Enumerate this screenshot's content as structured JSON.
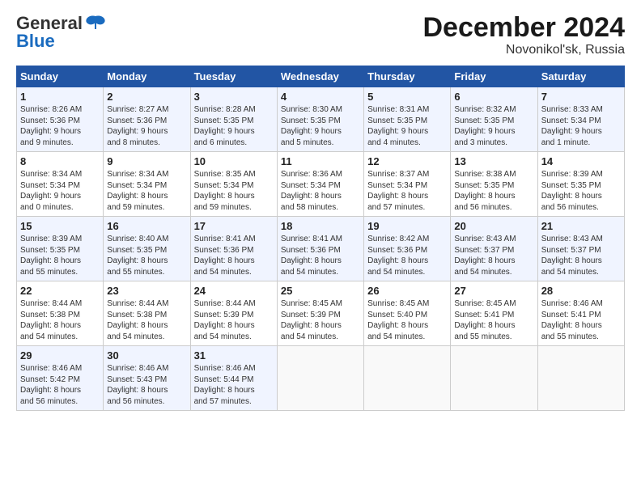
{
  "header": {
    "logo_general": "General",
    "logo_blue": "Blue",
    "title": "December 2024",
    "subtitle": "Novonikol'sk, Russia"
  },
  "columns": [
    "Sunday",
    "Monday",
    "Tuesday",
    "Wednesday",
    "Thursday",
    "Friday",
    "Saturday"
  ],
  "weeks": [
    [
      {
        "day": "1",
        "info": "Sunrise: 8:26 AM\nSunset: 5:36 PM\nDaylight: 9 hours\nand 9 minutes."
      },
      {
        "day": "2",
        "info": "Sunrise: 8:27 AM\nSunset: 5:36 PM\nDaylight: 9 hours\nand 8 minutes."
      },
      {
        "day": "3",
        "info": "Sunrise: 8:28 AM\nSunset: 5:35 PM\nDaylight: 9 hours\nand 6 minutes."
      },
      {
        "day": "4",
        "info": "Sunrise: 8:30 AM\nSunset: 5:35 PM\nDaylight: 9 hours\nand 5 minutes."
      },
      {
        "day": "5",
        "info": "Sunrise: 8:31 AM\nSunset: 5:35 PM\nDaylight: 9 hours\nand 4 minutes."
      },
      {
        "day": "6",
        "info": "Sunrise: 8:32 AM\nSunset: 5:35 PM\nDaylight: 9 hours\nand 3 minutes."
      },
      {
        "day": "7",
        "info": "Sunrise: 8:33 AM\nSunset: 5:34 PM\nDaylight: 9 hours\nand 1 minute."
      }
    ],
    [
      {
        "day": "8",
        "info": "Sunrise: 8:34 AM\nSunset: 5:34 PM\nDaylight: 9 hours\nand 0 minutes."
      },
      {
        "day": "9",
        "info": "Sunrise: 8:34 AM\nSunset: 5:34 PM\nDaylight: 8 hours\nand 59 minutes."
      },
      {
        "day": "10",
        "info": "Sunrise: 8:35 AM\nSunset: 5:34 PM\nDaylight: 8 hours\nand 59 minutes."
      },
      {
        "day": "11",
        "info": "Sunrise: 8:36 AM\nSunset: 5:34 PM\nDaylight: 8 hours\nand 58 minutes."
      },
      {
        "day": "12",
        "info": "Sunrise: 8:37 AM\nSunset: 5:34 PM\nDaylight: 8 hours\nand 57 minutes."
      },
      {
        "day": "13",
        "info": "Sunrise: 8:38 AM\nSunset: 5:35 PM\nDaylight: 8 hours\nand 56 minutes."
      },
      {
        "day": "14",
        "info": "Sunrise: 8:39 AM\nSunset: 5:35 PM\nDaylight: 8 hours\nand 56 minutes."
      }
    ],
    [
      {
        "day": "15",
        "info": "Sunrise: 8:39 AM\nSunset: 5:35 PM\nDaylight: 8 hours\nand 55 minutes."
      },
      {
        "day": "16",
        "info": "Sunrise: 8:40 AM\nSunset: 5:35 PM\nDaylight: 8 hours\nand 55 minutes."
      },
      {
        "day": "17",
        "info": "Sunrise: 8:41 AM\nSunset: 5:36 PM\nDaylight: 8 hours\nand 54 minutes."
      },
      {
        "day": "18",
        "info": "Sunrise: 8:41 AM\nSunset: 5:36 PM\nDaylight: 8 hours\nand 54 minutes."
      },
      {
        "day": "19",
        "info": "Sunrise: 8:42 AM\nSunset: 5:36 PM\nDaylight: 8 hours\nand 54 minutes."
      },
      {
        "day": "20",
        "info": "Sunrise: 8:43 AM\nSunset: 5:37 PM\nDaylight: 8 hours\nand 54 minutes."
      },
      {
        "day": "21",
        "info": "Sunrise: 8:43 AM\nSunset: 5:37 PM\nDaylight: 8 hours\nand 54 minutes."
      }
    ],
    [
      {
        "day": "22",
        "info": "Sunrise: 8:44 AM\nSunset: 5:38 PM\nDaylight: 8 hours\nand 54 minutes."
      },
      {
        "day": "23",
        "info": "Sunrise: 8:44 AM\nSunset: 5:38 PM\nDaylight: 8 hours\nand 54 minutes."
      },
      {
        "day": "24",
        "info": "Sunrise: 8:44 AM\nSunset: 5:39 PM\nDaylight: 8 hours\nand 54 minutes."
      },
      {
        "day": "25",
        "info": "Sunrise: 8:45 AM\nSunset: 5:39 PM\nDaylight: 8 hours\nand 54 minutes."
      },
      {
        "day": "26",
        "info": "Sunrise: 8:45 AM\nSunset: 5:40 PM\nDaylight: 8 hours\nand 54 minutes."
      },
      {
        "day": "27",
        "info": "Sunrise: 8:45 AM\nSunset: 5:41 PM\nDaylight: 8 hours\nand 55 minutes."
      },
      {
        "day": "28",
        "info": "Sunrise: 8:46 AM\nSunset: 5:41 PM\nDaylight: 8 hours\nand 55 minutes."
      }
    ],
    [
      {
        "day": "29",
        "info": "Sunrise: 8:46 AM\nSunset: 5:42 PM\nDaylight: 8 hours\nand 56 minutes."
      },
      {
        "day": "30",
        "info": "Sunrise: 8:46 AM\nSunset: 5:43 PM\nDaylight: 8 hours\nand 56 minutes."
      },
      {
        "day": "31",
        "info": "Sunrise: 8:46 AM\nSunset: 5:44 PM\nDaylight: 8 hours\nand 57 minutes."
      },
      null,
      null,
      null,
      null
    ]
  ]
}
